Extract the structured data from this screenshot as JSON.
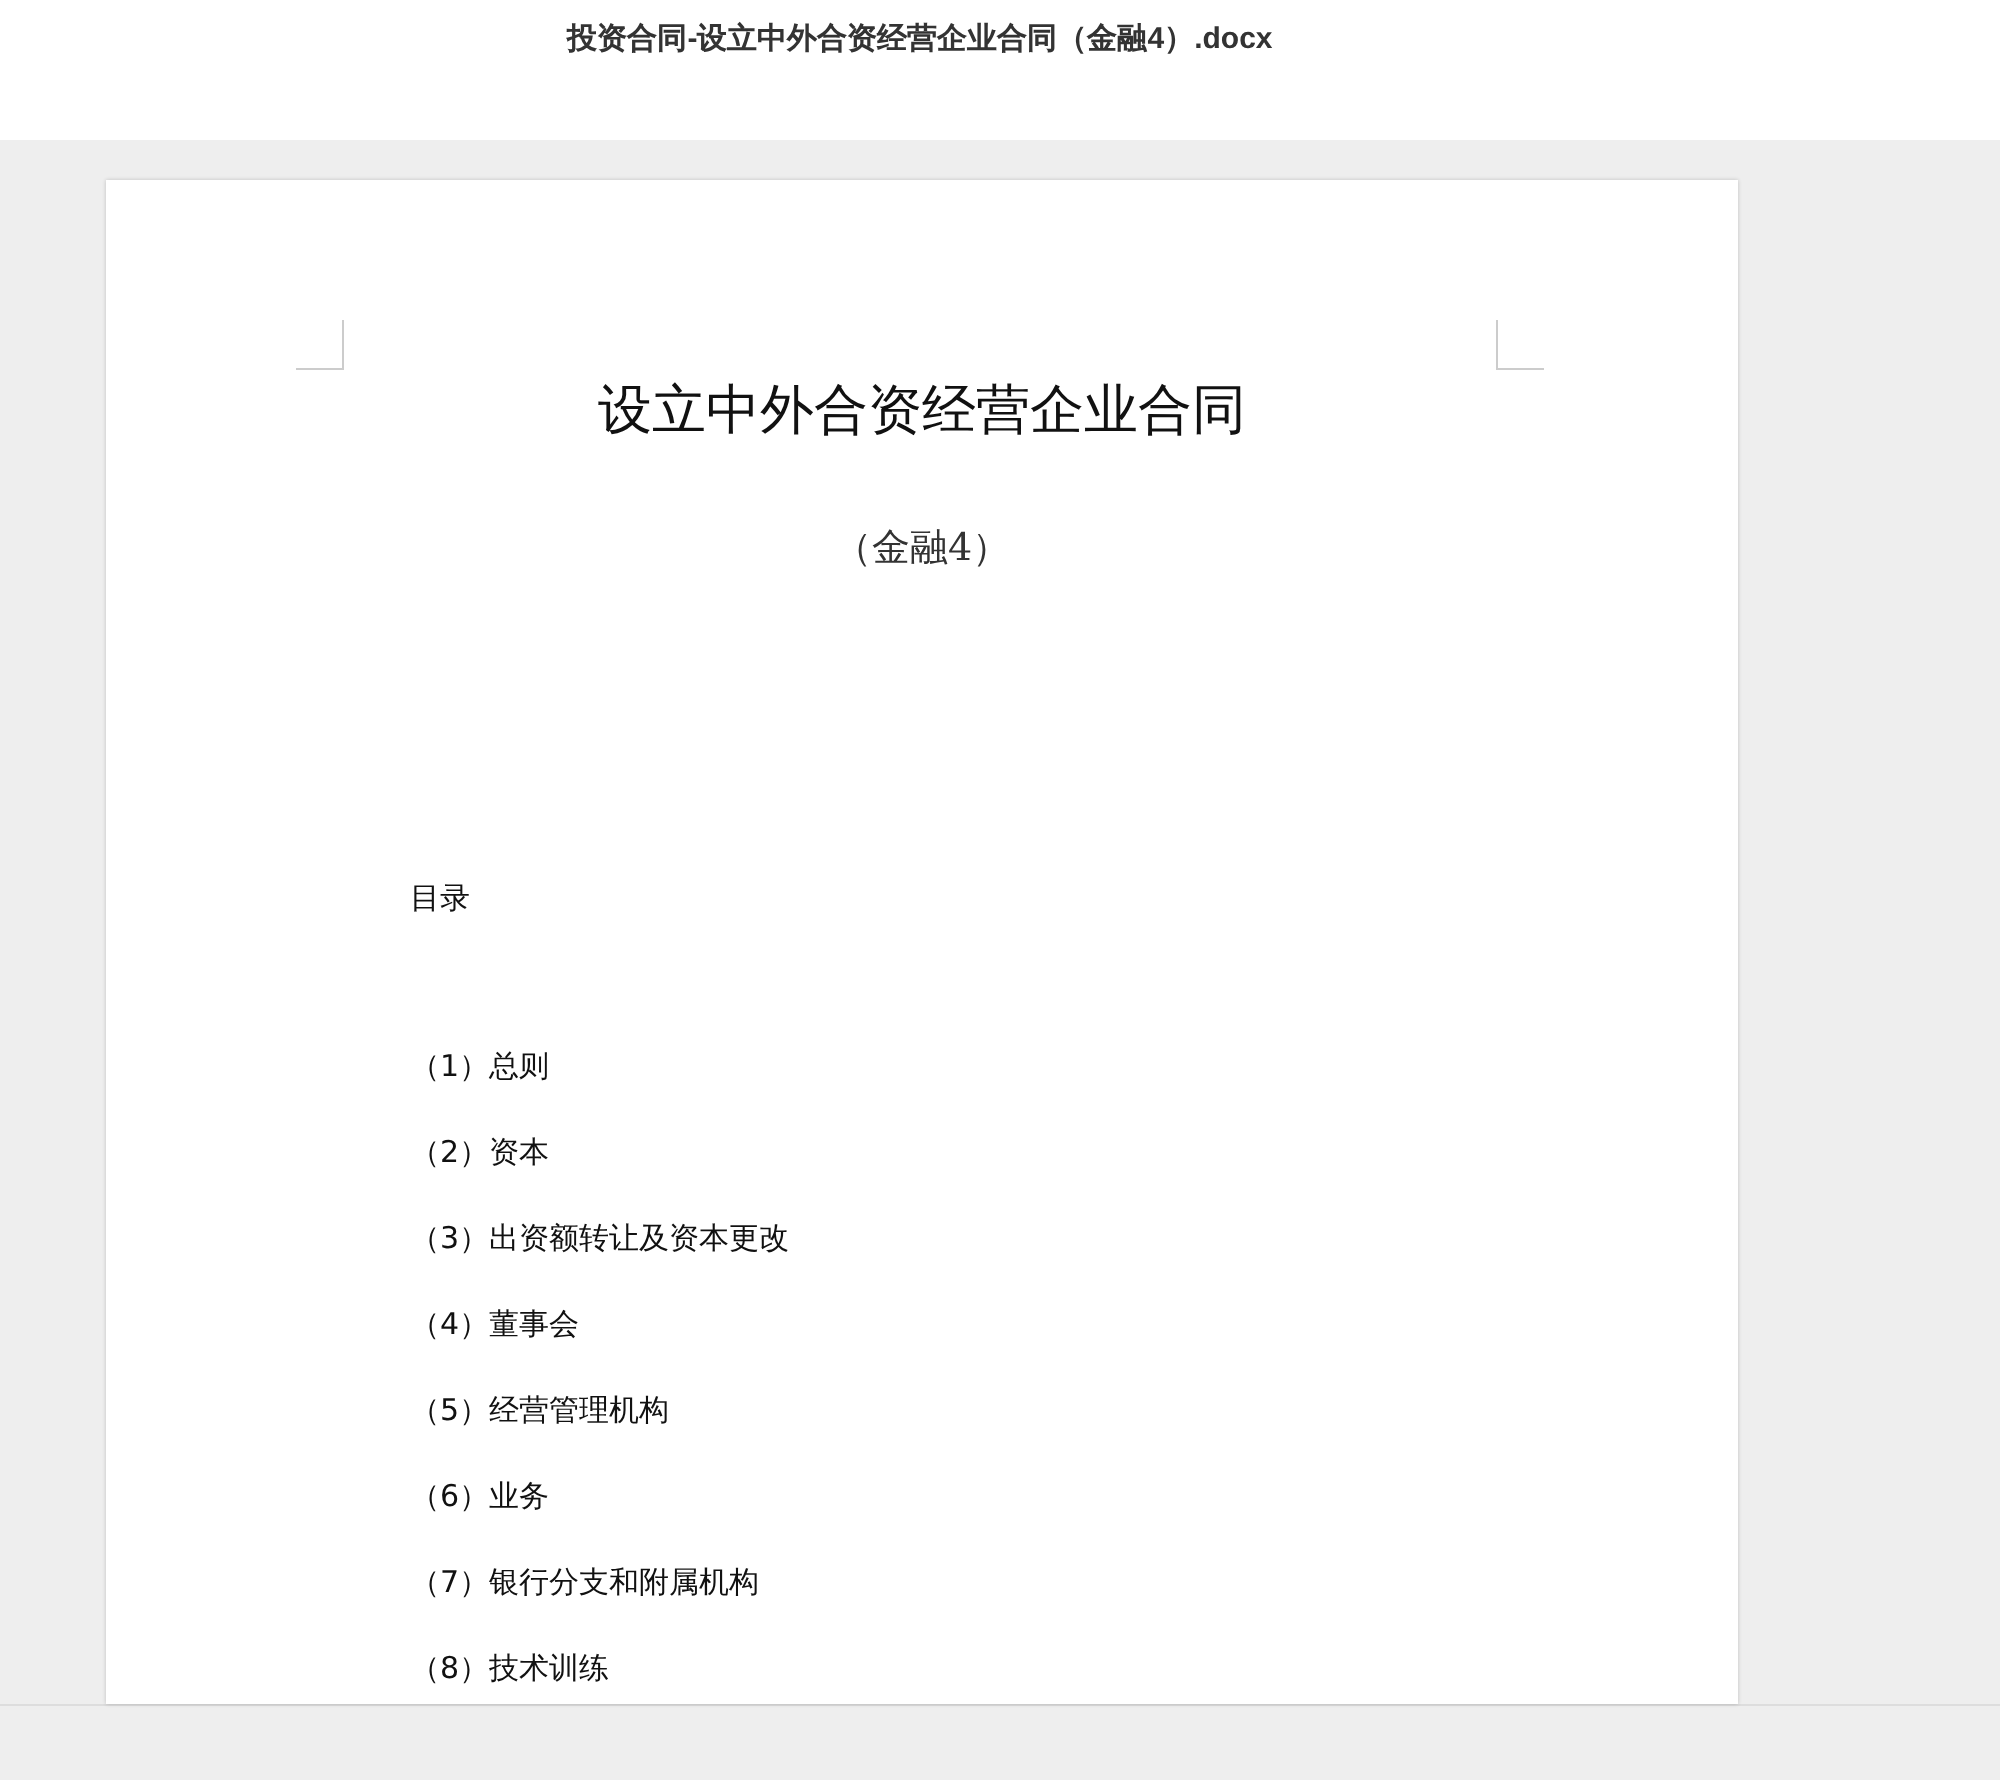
{
  "window": {
    "title": "投资合同-设立中外合资经营企业合同（金融4）.docx"
  },
  "document": {
    "title": "设立中外合资经营企业合同",
    "subtitle": "（金融4）",
    "toc_heading": "目录",
    "toc_items": [
      "（1）总则",
      "（2）资本",
      "（3）出资额转让及资本更改",
      "（4）董事会",
      "（5）经营管理机构",
      "（6）业务",
      "（7）银行分支和附属机构",
      "（8）技术训练"
    ]
  }
}
